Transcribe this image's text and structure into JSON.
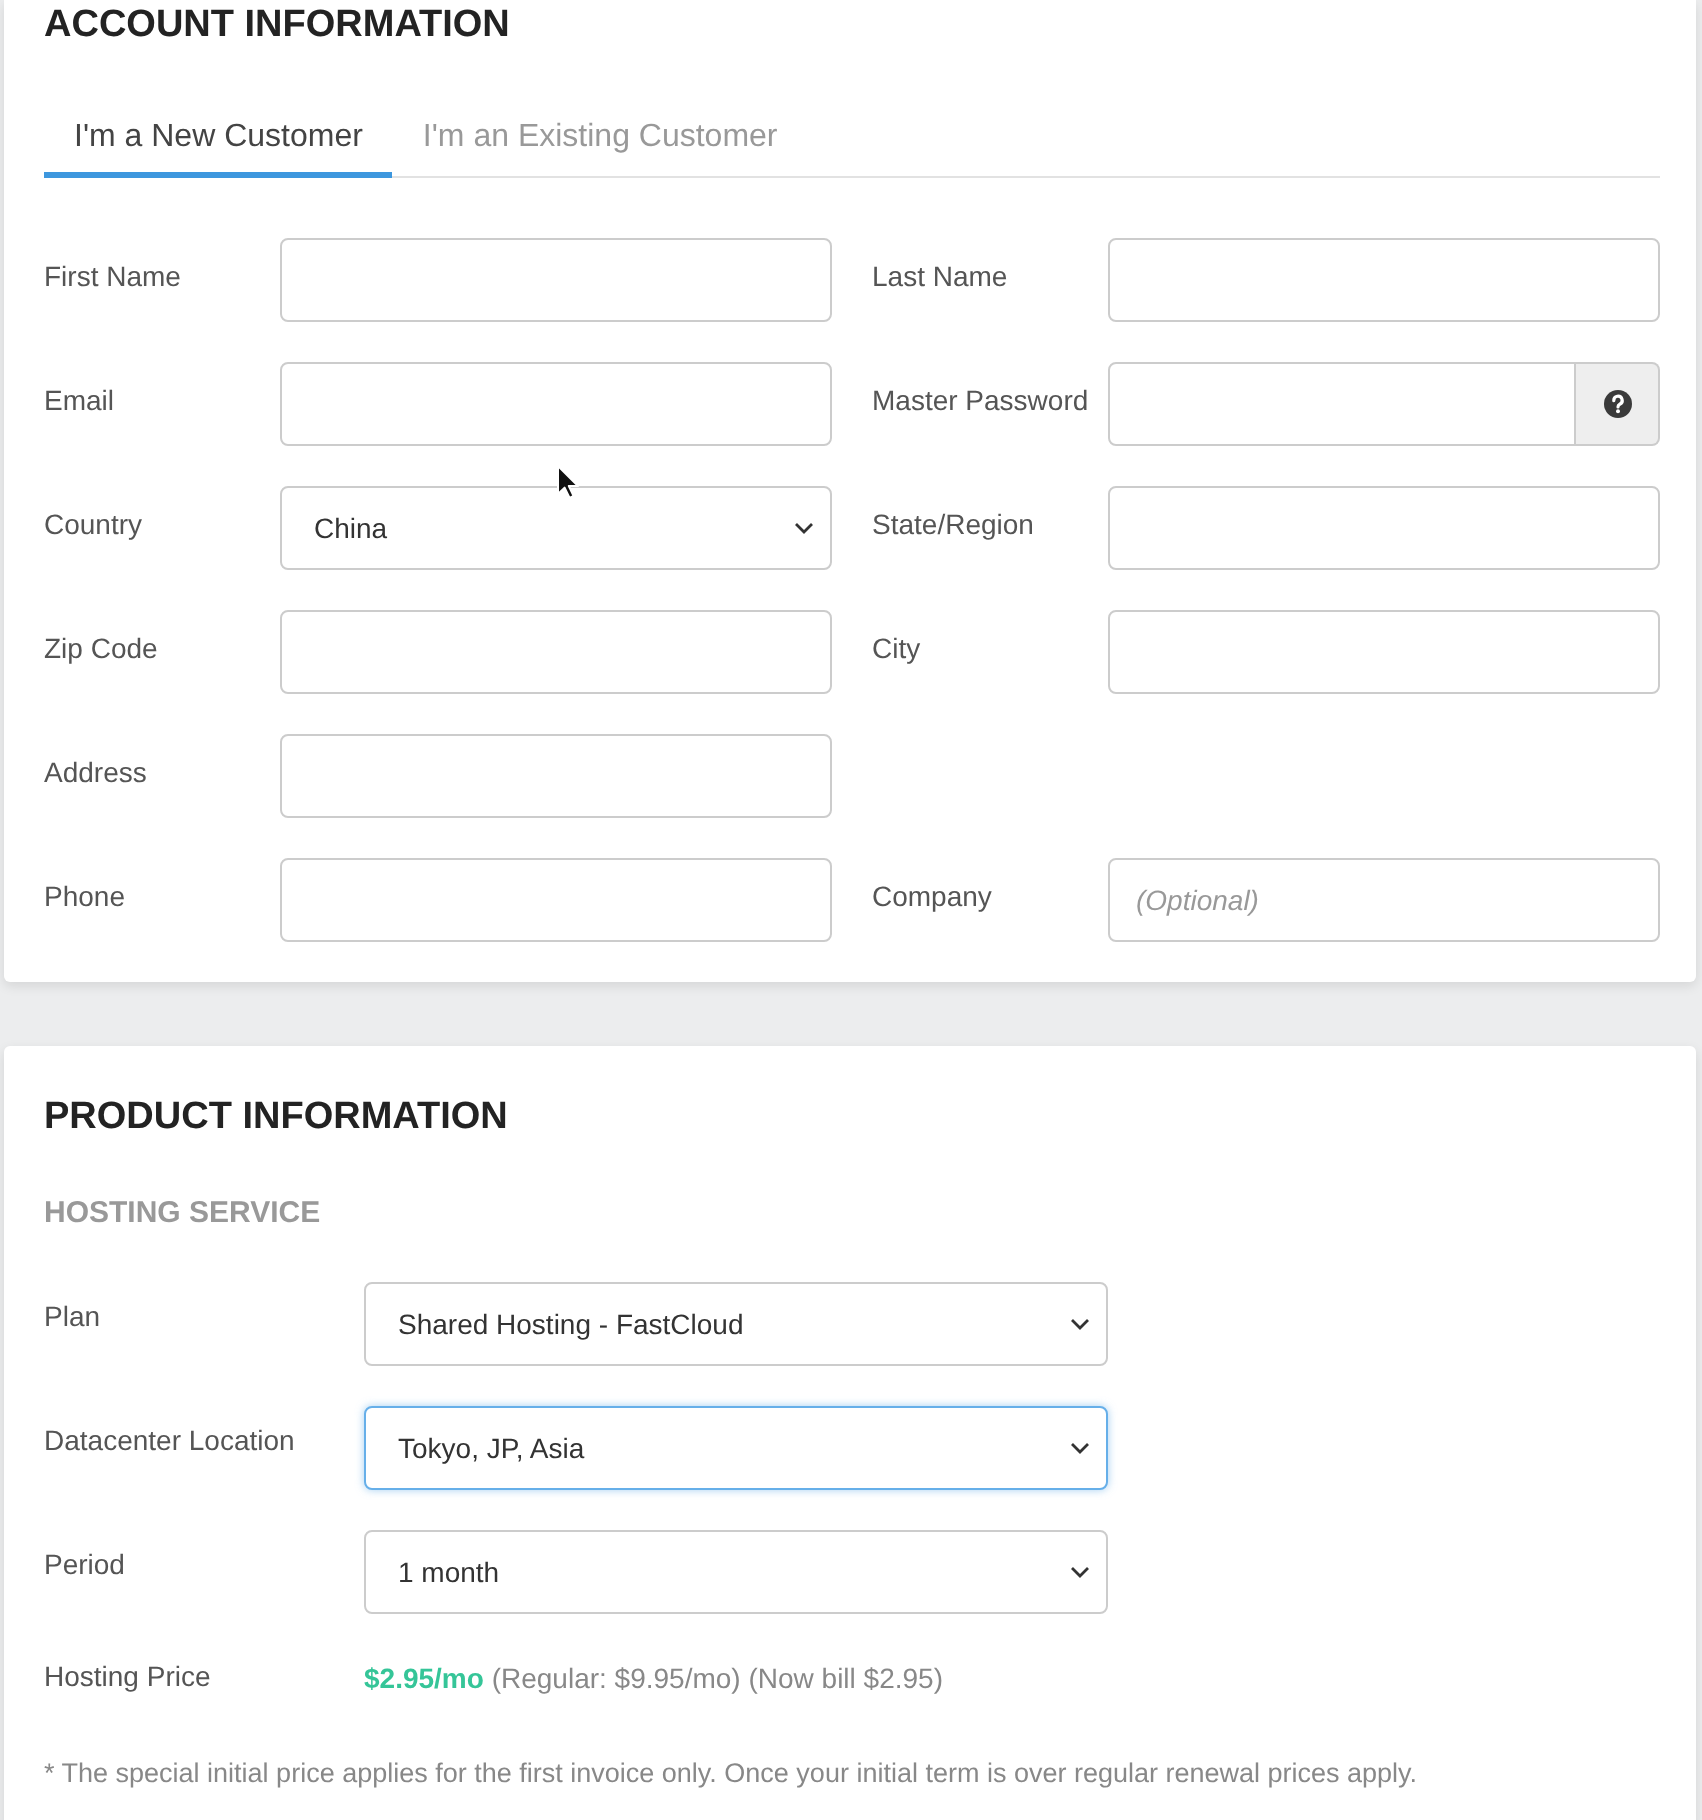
{
  "account": {
    "title": "ACCOUNT INFORMATION",
    "tabs": [
      {
        "label": "I'm a New Customer",
        "selected": true
      },
      {
        "label": "I'm an Existing Customer",
        "selected": false
      }
    ],
    "rows": [
      [
        {
          "label": "First Name",
          "kind": "text"
        },
        {
          "label": "Last Name",
          "kind": "text"
        }
      ],
      [
        {
          "label": "Email",
          "kind": "text"
        },
        {
          "label": "Master Password",
          "kind": "password"
        }
      ],
      [
        {
          "label": "Country",
          "kind": "select",
          "value": "China"
        },
        {
          "label": "State/Region",
          "kind": "text"
        }
      ],
      [
        {
          "label": "Zip Code",
          "kind": "text"
        },
        {
          "label": "City",
          "kind": "text"
        }
      ],
      [
        {
          "label": "Address",
          "kind": "text"
        }
      ],
      [
        {
          "label": "Phone",
          "kind": "text"
        },
        {
          "label": "Company",
          "kind": "text",
          "placeholder": "(Optional)"
        }
      ]
    ]
  },
  "product": {
    "title": "PRODUCT INFORMATION",
    "subtitle": "HOSTING SERVICE",
    "fields": [
      {
        "label": "Plan",
        "value": "Shared Hosting - FastCloud",
        "focused": false
      },
      {
        "label": "Datacenter Location",
        "value": "Tokyo, JP, Asia",
        "focused": true
      },
      {
        "label": "Period",
        "value": "1 month",
        "focused": false
      }
    ],
    "price": {
      "label": "Hosting Price",
      "text": "**$2.95/mo** (Regular: $9.95/mo) (Now bill $2.95)"
    },
    "note": "* The special initial price applies for the first invoice only. Once your initial term is over regular renewal prices apply."
  }
}
